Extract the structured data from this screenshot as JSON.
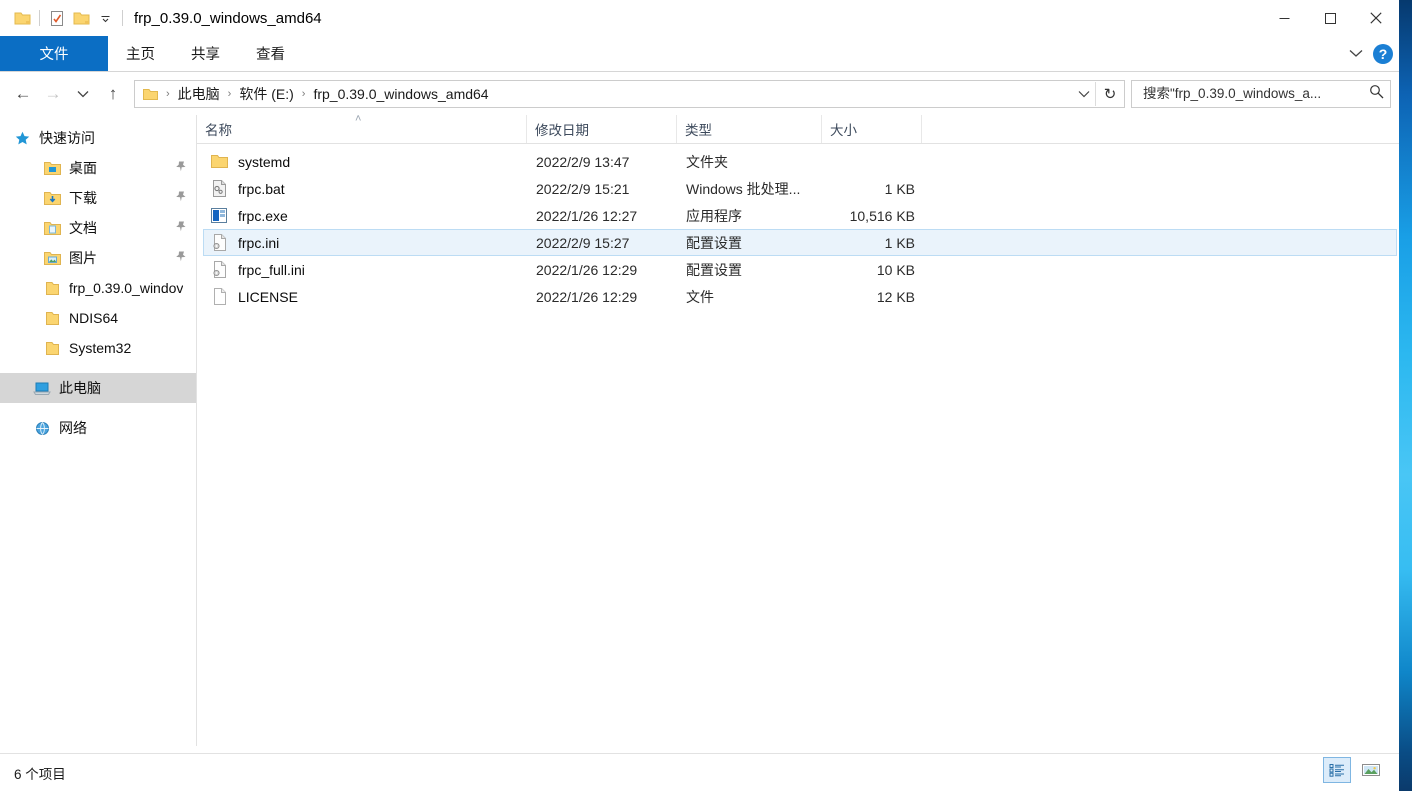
{
  "window": {
    "title": "frp_0.39.0_windows_amd64",
    "quick_access": [
      {
        "name": "folder-icon",
        "label": "folder"
      },
      {
        "name": "properties-icon",
        "label": "properties"
      },
      {
        "name": "new-folder-icon",
        "label": "new folder"
      },
      {
        "name": "chevron-down-icon",
        "label": "customize"
      }
    ],
    "controls": {
      "minimize": "─",
      "maximize": "□",
      "close": "✕"
    }
  },
  "ribbon": {
    "tabs": [
      {
        "label": "文件",
        "active": true
      },
      {
        "label": "主页",
        "active": false
      },
      {
        "label": "共享",
        "active": false
      },
      {
        "label": "查看",
        "active": false
      }
    ],
    "expand": "⌄",
    "help": "?"
  },
  "address": {
    "back": "←",
    "forward": "→",
    "recent": "⌄",
    "up": "↑",
    "crumbs": [
      "此电脑",
      "软件 (E:)",
      "frp_0.39.0_windows_amd64"
    ],
    "separator": "›",
    "dropdown": "⌄",
    "refresh": "↻"
  },
  "search": {
    "placeholder": "搜索\"frp_0.39.0_windows_a...",
    "value": "",
    "icon": "search-icon"
  },
  "sidebar": {
    "items": [
      {
        "label": "快速访问",
        "icon": "star-icon",
        "level": 0,
        "pinned": false,
        "selected": false
      },
      {
        "label": "桌面",
        "icon": "desktop-folder-icon",
        "level": 1,
        "pinned": true,
        "selected": false
      },
      {
        "label": "下载",
        "icon": "downloads-folder-icon",
        "level": 1,
        "pinned": true,
        "selected": false
      },
      {
        "label": "文档",
        "icon": "documents-folder-icon",
        "level": 1,
        "pinned": true,
        "selected": false
      },
      {
        "label": "图片",
        "icon": "pictures-folder-icon",
        "level": 1,
        "pinned": true,
        "selected": false
      },
      {
        "label": "frp_0.39.0_windov",
        "icon": "folder-icon",
        "level": 1,
        "pinned": false,
        "selected": false
      },
      {
        "label": "NDIS64",
        "icon": "folder-icon",
        "level": 1,
        "pinned": false,
        "selected": false
      },
      {
        "label": "System32",
        "icon": "folder-icon",
        "level": 1,
        "pinned": false,
        "selected": false
      },
      {
        "label": "此电脑",
        "icon": "this-pc-icon",
        "level": 0,
        "pinned": false,
        "selected": true
      },
      {
        "label": "网络",
        "icon": "network-icon",
        "level": 0,
        "pinned": false,
        "selected": false
      }
    ],
    "pin_glyph": "📌"
  },
  "filelist": {
    "columns": [
      {
        "key": "name",
        "label": "名称",
        "sorted": "asc"
      },
      {
        "key": "date",
        "label": "修改日期",
        "sorted": ""
      },
      {
        "key": "type",
        "label": "类型",
        "sorted": ""
      },
      {
        "key": "size",
        "label": "大小",
        "sorted": ""
      }
    ],
    "sort_caret": "˄",
    "rows": [
      {
        "name": "systemd",
        "date": "2022/2/9 13:47",
        "type": "文件夹",
        "size": "",
        "icon": "folder-icon",
        "selected": false
      },
      {
        "name": "frpc.bat",
        "date": "2022/2/9 15:21",
        "type": "Windows 批处理...",
        "size": "1 KB",
        "icon": "bat-file-icon",
        "selected": false
      },
      {
        "name": "frpc.exe",
        "date": "2022/1/26 12:27",
        "type": "应用程序",
        "size": "10,516 KB",
        "icon": "exe-file-icon",
        "selected": false
      },
      {
        "name": "frpc.ini",
        "date": "2022/2/9 15:27",
        "type": "配置设置",
        "size": "1 KB",
        "icon": "ini-file-icon",
        "selected": true
      },
      {
        "name": "frpc_full.ini",
        "date": "2022/1/26 12:29",
        "type": "配置设置",
        "size": "10 KB",
        "icon": "ini-file-icon",
        "selected": false
      },
      {
        "name": "LICENSE",
        "date": "2022/1/26 12:29",
        "type": "文件",
        "size": "12 KB",
        "icon": "generic-file-icon",
        "selected": false
      }
    ]
  },
  "statusbar": {
    "item_count": "6 个项目",
    "views": [
      {
        "name": "details-view-button",
        "active": true
      },
      {
        "name": "large-icons-view-button",
        "active": false
      }
    ]
  },
  "colors": {
    "accent": "#0b6ec4",
    "selection_fill": "#eaf3fb",
    "selection_border": "#bcdcf4",
    "nav_selection": "#d6d6d6",
    "folder_yellow": "#fbd570"
  }
}
